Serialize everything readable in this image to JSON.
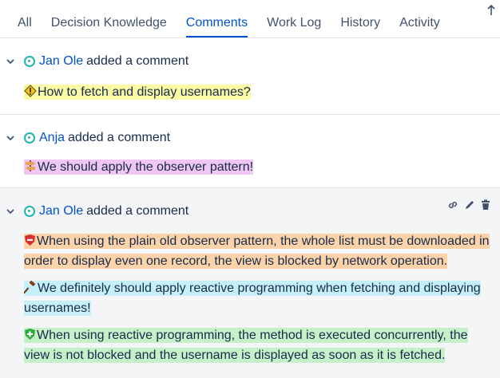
{
  "tabs": [
    {
      "label": "All",
      "active": false
    },
    {
      "label": "Decision Knowledge",
      "active": false
    },
    {
      "label": "Comments",
      "active": true
    },
    {
      "label": "Work Log",
      "active": false
    },
    {
      "label": "History",
      "active": false
    },
    {
      "label": "Activity",
      "active": false
    }
  ],
  "scroll_icon": "arrow-up-icon",
  "colors": {
    "link": "#0052cc",
    "avatar": "#1fb5b0",
    "issue": "#fafaa5",
    "decision": "#f0c6f3",
    "con": "#fcd3a8",
    "alternative": "#c6f0f8",
    "pro": "#c5f0c8"
  },
  "comments": [
    {
      "author": "Jan Ole",
      "action": "added a comment",
      "elements": [
        {
          "type": "issue",
          "icon": "issue-diamond-icon",
          "text": "How to fetch and display usernames?"
        }
      ]
    },
    {
      "author": "Anja",
      "action": "added a comment",
      "elements": [
        {
          "type": "decision",
          "icon": "signpost-icon",
          "text": "We should apply the observer pattern!"
        }
      ]
    },
    {
      "author": "Jan Ole",
      "action": "added a comment",
      "tools": [
        "link-icon",
        "pencil-icon",
        "trash-icon"
      ],
      "elements": [
        {
          "type": "con",
          "icon": "con-shield-icon",
          "text": "When using the plain old observer pattern, the whole list must be downloaded in order to display even one record, the view is blocked by network operation."
        },
        {
          "type": "alternative",
          "icon": "gavel-icon",
          "text": "We definitely should apply reactive programming when fetching and displaying usernames!"
        },
        {
          "type": "pro",
          "icon": "pro-shield-icon",
          "text": "When using reactive programming, the method is executed concurrently, the view is not blocked and the username is displayed as soon as it is fetched."
        }
      ]
    }
  ]
}
